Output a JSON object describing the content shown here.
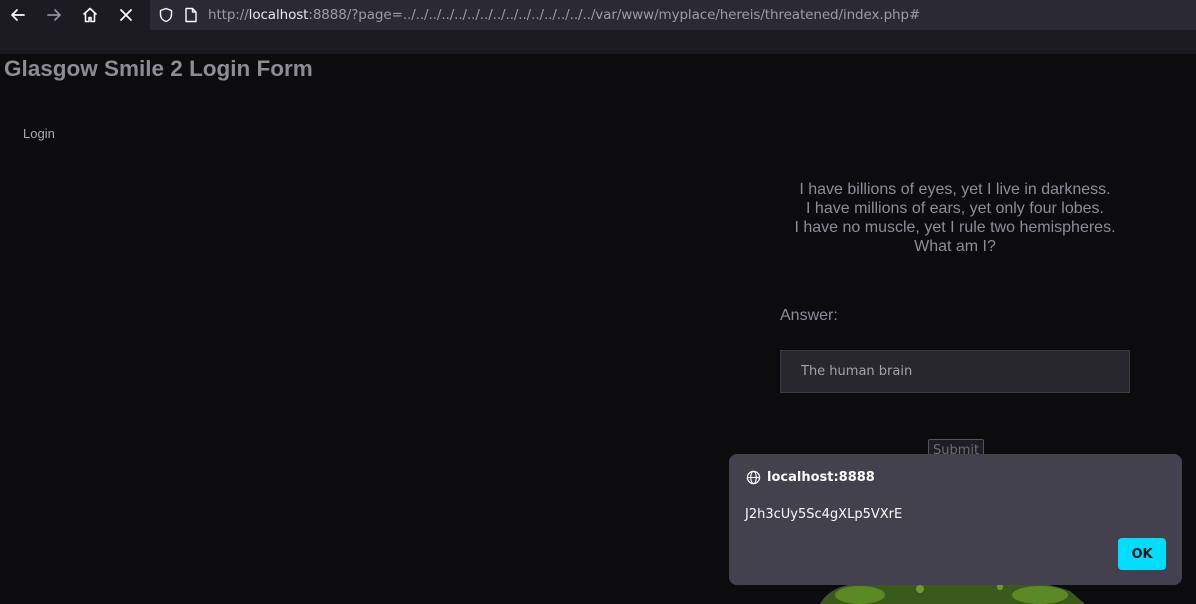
{
  "browser": {
    "url_prefix": "http://",
    "url_host": "localhost",
    "url_rest": ":8888/?page=../../../../../../../../../../../../../../../var/www/myplace/hereis/threatened/index.php#"
  },
  "page": {
    "title": "Glasgow Smile 2 Login Form",
    "login_link": "Login",
    "riddle_lines": [
      "I have billions of eyes, yet I live in darkness.",
      "I have millions of ears, yet only four lobes.",
      "I have no muscle, yet I rule two hemispheres.",
      "What am I?"
    ],
    "answer_label": "Answer:",
    "answer_value": "The human brain",
    "submit_label": "Submit"
  },
  "dialog": {
    "host": "localhost:8888",
    "message": "J2h3cUy5Sc4gXLp5VXrE",
    "ok_label": "OK"
  },
  "colors": {
    "accent": "#00ddff",
    "dialog_bg": "#42414d",
    "page_bg": "#0c0c0f"
  }
}
